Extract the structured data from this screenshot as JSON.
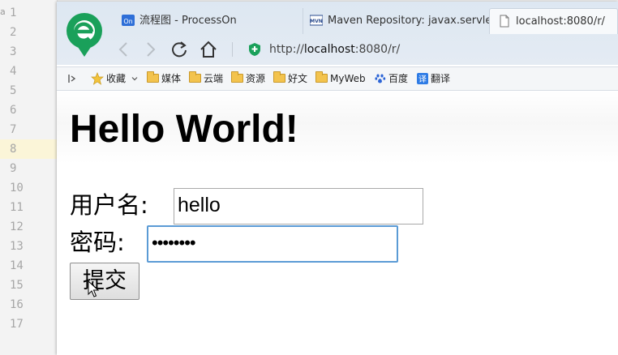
{
  "editor": {
    "line_numbers": [
      "1",
      "2",
      "3",
      "4",
      "5",
      "6",
      "7",
      "8",
      "9",
      "10",
      "11",
      "12",
      "13",
      "14",
      "15",
      "16",
      "17"
    ],
    "edge_text": "a"
  },
  "browser": {
    "tabs": [
      {
        "icon": "processon-icon",
        "label": "流程图 - ProcessOn"
      },
      {
        "icon": "maven-icon",
        "label": "Maven Repository: javax.servle"
      },
      {
        "icon": "page-icon",
        "label": "localhost:8080/r/"
      }
    ],
    "address": {
      "scheme": "http://",
      "host": "localhost",
      "rest": ":8080/r/"
    },
    "bookmarks": [
      {
        "icon": "star-icon",
        "label": "收藏"
      },
      {
        "icon": "folder-icon",
        "label": "媒体"
      },
      {
        "icon": "folder-icon",
        "label": "云端"
      },
      {
        "icon": "folder-icon",
        "label": "资源"
      },
      {
        "icon": "folder-icon",
        "label": "好文"
      },
      {
        "icon": "folder-icon",
        "label": "MyWeb"
      },
      {
        "icon": "paw-icon",
        "label": "百度"
      },
      {
        "icon": "translate-icon",
        "label": "翻译"
      }
    ],
    "colors": {
      "accent_green": "#1aa05a",
      "focus_blue": "#5b9bd5"
    }
  },
  "page": {
    "heading": "Hello World!",
    "username_label": "用户名:",
    "username_value": "hello",
    "password_label": "密码:",
    "password_mask": "••••••••",
    "submit_label": "提交"
  }
}
